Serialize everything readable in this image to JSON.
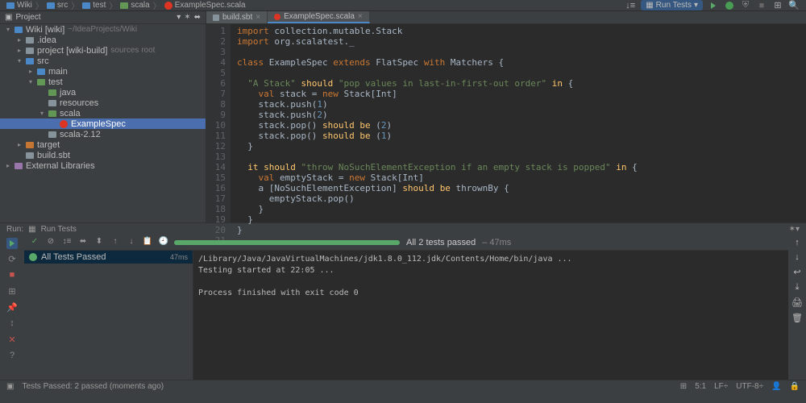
{
  "breadcrumb": [
    "Wiki",
    "src",
    "test",
    "scala",
    "ExampleSpec.scala"
  ],
  "run_config": "Run Tests",
  "sidebar": {
    "header": "Project",
    "tree": [
      {
        "indent": 0,
        "arrow": "▾",
        "icon": "folder-blue",
        "label": "Wiki [wiki]",
        "hint": "~/IdeaProjects/Wiki"
      },
      {
        "indent": 1,
        "arrow": "▸",
        "icon": "folder",
        "label": ".idea"
      },
      {
        "indent": 1,
        "arrow": "▸",
        "icon": "folder",
        "label": "project [wiki-build]",
        "hint": "sources root"
      },
      {
        "indent": 1,
        "arrow": "▾",
        "icon": "folder-blue",
        "label": "src"
      },
      {
        "indent": 2,
        "arrow": "▸",
        "icon": "folder-blue",
        "label": "main"
      },
      {
        "indent": 2,
        "arrow": "▾",
        "icon": "folder-green",
        "label": "test"
      },
      {
        "indent": 3,
        "arrow": "",
        "icon": "folder-green",
        "label": "java"
      },
      {
        "indent": 3,
        "arrow": "",
        "icon": "folder",
        "label": "resources"
      },
      {
        "indent": 3,
        "arrow": "▾",
        "icon": "folder-green",
        "label": "scala"
      },
      {
        "indent": 4,
        "arrow": "",
        "icon": "scala",
        "label": "ExampleSpec",
        "sel": true
      },
      {
        "indent": 3,
        "arrow": "",
        "icon": "folder",
        "label": "scala-2.12"
      },
      {
        "indent": 1,
        "arrow": "▸",
        "icon": "folder-orange",
        "label": "target"
      },
      {
        "indent": 1,
        "arrow": "",
        "icon": "file",
        "label": "build.sbt"
      },
      {
        "indent": 0,
        "arrow": "▸",
        "icon": "lib",
        "label": "External Libraries"
      }
    ]
  },
  "tabs": [
    {
      "icon": "file",
      "label": "build.sbt",
      "active": false
    },
    {
      "icon": "scala",
      "label": "ExampleSpec.scala",
      "active": true
    }
  ],
  "code": [
    [
      [
        "kw",
        "import"
      ],
      [
        "",
        " collection.mutable.Stack"
      ]
    ],
    [
      [
        "kw",
        "import"
      ],
      [
        "",
        " org.scalatest._"
      ]
    ],
    [
      [
        "",
        ""
      ]
    ],
    [
      [
        "kw",
        "class"
      ],
      [
        "",
        " ExampleSpec "
      ],
      [
        "kw",
        "extends"
      ],
      [
        "",
        " FlatSpec "
      ],
      [
        "kw",
        "with"
      ],
      [
        "",
        " Matchers {"
      ]
    ],
    [
      [
        "",
        ""
      ]
    ],
    [
      [
        "",
        "  "
      ],
      [
        "str",
        "\"A Stack\""
      ],
      [
        "",
        " "
      ],
      [
        "fn",
        "should"
      ],
      [
        "",
        " "
      ],
      [
        "str",
        "\"pop values in last-in-first-out order\""
      ],
      [
        "",
        " "
      ],
      [
        "fn",
        "in"
      ],
      [
        "",
        " {"
      ]
    ],
    [
      [
        "",
        "    "
      ],
      [
        "kw",
        "val"
      ],
      [
        "",
        " stack = "
      ],
      [
        "kw",
        "new"
      ],
      [
        "",
        " Stack["
      ],
      [
        "typ",
        "Int"
      ],
      [
        "",
        "]"
      ]
    ],
    [
      [
        "",
        "    stack.push("
      ],
      [
        "num",
        "1"
      ],
      [
        "",
        ")"
      ]
    ],
    [
      [
        "",
        "    stack.push("
      ],
      [
        "num",
        "2"
      ],
      [
        "",
        ")"
      ]
    ],
    [
      [
        "",
        "    stack.pop() "
      ],
      [
        "fn",
        "should"
      ],
      [
        "",
        " "
      ],
      [
        "fn",
        "be"
      ],
      [
        "",
        " ("
      ],
      [
        "num",
        "2"
      ],
      [
        "",
        ")"
      ]
    ],
    [
      [
        "",
        "    stack.pop() "
      ],
      [
        "fn",
        "should"
      ],
      [
        "",
        " "
      ],
      [
        "fn",
        "be"
      ],
      [
        "",
        " ("
      ],
      [
        "num",
        "1"
      ],
      [
        "",
        ")"
      ]
    ],
    [
      [
        "",
        "  }"
      ]
    ],
    [
      [
        "",
        ""
      ]
    ],
    [
      [
        "",
        "  "
      ],
      [
        "fn",
        "it"
      ],
      [
        "",
        " "
      ],
      [
        "fn",
        "should"
      ],
      [
        "",
        " "
      ],
      [
        "str",
        "\"throw NoSuchElementException if an empty stack is popped\""
      ],
      [
        "",
        " "
      ],
      [
        "fn",
        "in"
      ],
      [
        "",
        " {"
      ]
    ],
    [
      [
        "",
        "    "
      ],
      [
        "kw",
        "val"
      ],
      [
        "",
        " emptyStack = "
      ],
      [
        "kw",
        "new"
      ],
      [
        "",
        " Stack["
      ],
      [
        "typ",
        "Int"
      ],
      [
        "",
        "]"
      ]
    ],
    [
      [
        "",
        "    a ["
      ],
      [
        "typ",
        "NoSuchElementException"
      ],
      [
        "",
        "] "
      ],
      [
        "fn",
        "should"
      ],
      [
        "",
        " "
      ],
      [
        "fn",
        "be"
      ],
      [
        "",
        " thrownBy {"
      ]
    ],
    [
      [
        "",
        "      emptyStack.pop()"
      ]
    ],
    [
      [
        "",
        "    }"
      ]
    ],
    [
      [
        "",
        "  }"
      ]
    ],
    [
      [
        "",
        "}"
      ]
    ],
    [
      [
        "",
        ""
      ]
    ]
  ],
  "run": {
    "tab1": "Run:",
    "tab2": "Run Tests",
    "progress_text": "All 2 tests passed",
    "progress_time": "– 47ms",
    "tree_label": "All Tests Passed",
    "tree_time": "47ms",
    "console": [
      "/Library/Java/JavaVirtualMachines/jdk1.8.0_112.jdk/Contents/Home/bin/java ...",
      "Testing started at 22:05 ...",
      "",
      "Process finished with exit code 0"
    ]
  },
  "status": {
    "left": "Tests Passed: 2 passed (moments ago)",
    "pos": "5:1",
    "lf": "LF÷",
    "enc": "UTF-8÷"
  }
}
